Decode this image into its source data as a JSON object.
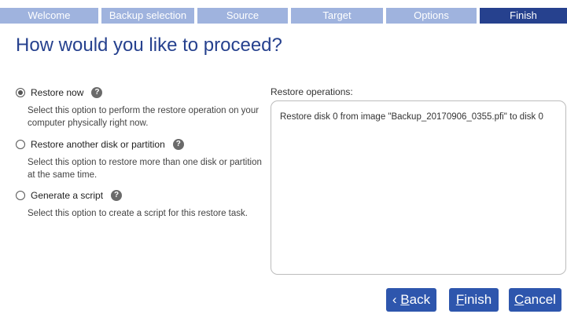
{
  "tabs": [
    {
      "label": "Welcome",
      "active": false
    },
    {
      "label": "Backup selection",
      "active": false
    },
    {
      "label": "Source",
      "active": false
    },
    {
      "label": "Target",
      "active": false
    },
    {
      "label": "Options",
      "active": false
    },
    {
      "label": "Finish",
      "active": true
    }
  ],
  "page_title": "How would you like to proceed?",
  "options": [
    {
      "label": "Restore now",
      "selected": true,
      "description": "Select this option to perform the restore operation on your computer physically right now."
    },
    {
      "label": "Restore another disk or partition",
      "selected": false,
      "description": "Select this option to restore more than one disk or partition at the same time."
    },
    {
      "label": "Generate a script",
      "selected": false,
      "description": "Select this option to create a script for this restore task."
    }
  ],
  "help_glyph": "?",
  "operations": {
    "label": "Restore operations:",
    "lines": [
      "Restore disk 0 from image \"Backup_20170906_0355.pfi\" to disk 0"
    ]
  },
  "buttons": {
    "back_prefix": "‹ ",
    "back_mnemonic": "B",
    "back_rest": "ack",
    "finish_mnemonic": "F",
    "finish_rest": "inish",
    "cancel_mnemonic": "C",
    "cancel_rest": "ancel"
  },
  "colors": {
    "tab_inactive": "#9fb3de",
    "tab_active": "#26418e",
    "title": "#26418e",
    "button": "#2e56ad"
  }
}
